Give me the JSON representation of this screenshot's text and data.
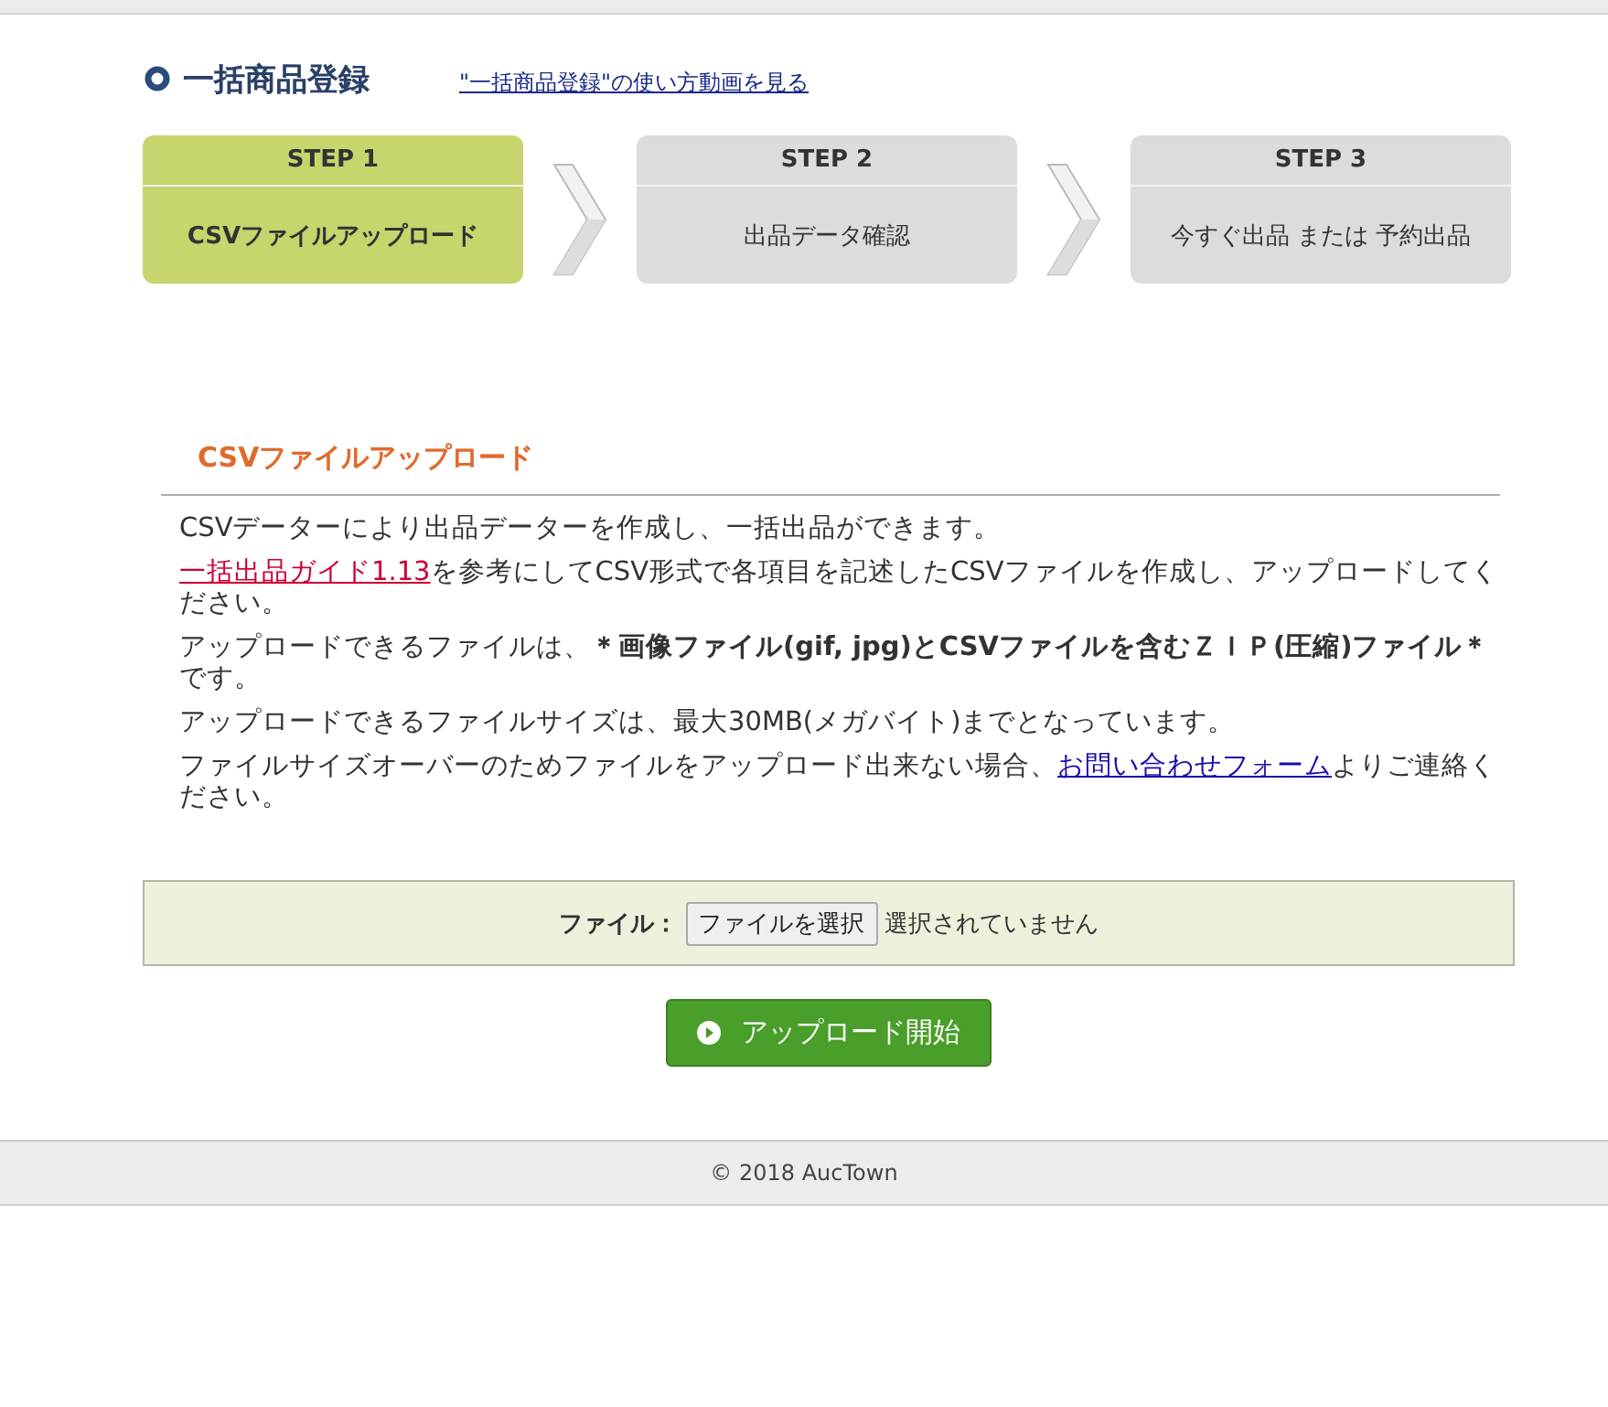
{
  "header": {
    "title": "一括商品登録",
    "video_link": "\"一括商品登録\"の使い方動画を見る"
  },
  "steps": [
    {
      "label": "STEP 1",
      "name": "CSVファイルアップロード",
      "selected": true
    },
    {
      "label": "STEP 2",
      "name": "出品データ確認",
      "selected": false
    },
    {
      "label": "STEP 3",
      "name": "今すぐ出品 または 予約出品",
      "selected": false
    }
  ],
  "section": {
    "heading": "CSVファイルアップロード",
    "paragraphs": [
      {
        "parts": [
          {
            "kind": "text",
            "text": "CSVデーターにより出品データーを作成し、一括出品ができます。"
          }
        ]
      },
      {
        "parts": [
          {
            "kind": "link",
            "text": "一括出品ガイド1.13",
            "color": "#cc0033"
          },
          {
            "kind": "text",
            "text": "を参考にしてCSV形式で各項目を記述したCSVファイルを作成し、アップロードしてください。"
          }
        ]
      },
      {
        "parts": [
          {
            "kind": "text",
            "text": "アップロードできるファイルは、**＊画像ファイル(gif, jpg)とCSVファイルを含むＺＩＰ(圧縮)ファイル＊**です。"
          }
        ]
      },
      {
        "parts": [
          {
            "kind": "text",
            "text": "アップロードできるファイルサイズは、最大30MB(メガバイト)までとなっています。"
          }
        ]
      },
      {
        "parts": [
          {
            "kind": "text",
            "text": "ファイルサイズオーバーのためファイルをアップロード出来ない場合、"
          },
          {
            "kind": "link",
            "text": "お問い合わせフォーム",
            "color": "#1a0dab"
          },
          {
            "kind": "text",
            "text": "よりご連絡ください。"
          }
        ]
      }
    ]
  },
  "upload": {
    "label": "ファイル：",
    "choose_button": "ファイルを選択",
    "status": "選択されていません",
    "submit": "アップロード開始"
  },
  "footer": {
    "copyright": "© 2018 AucTown"
  }
}
